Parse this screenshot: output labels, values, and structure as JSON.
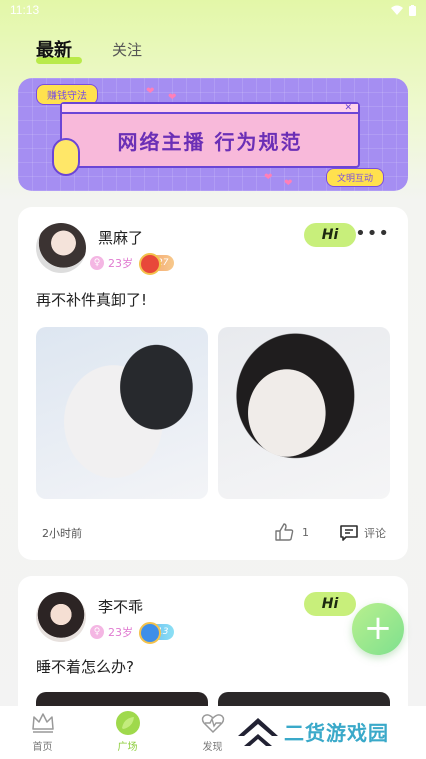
{
  "status_bar": {
    "time": "11:13"
  },
  "tabs": [
    {
      "label": "最新",
      "active": true
    },
    {
      "label": "关注",
      "active": false
    }
  ],
  "banner": {
    "tag": "赚钱守法",
    "title": "网络主播 行为规范",
    "sub": "文明互动"
  },
  "posts": [
    {
      "username": "黑麻了",
      "age": "23岁",
      "level": "27",
      "hi_label": "Hi",
      "text": "再不补件真卸了!",
      "time": "2小时前",
      "likes": "1",
      "comment_label": "评论"
    },
    {
      "username": "李不乖",
      "age": "23岁",
      "level": "13",
      "hi_label": "Hi",
      "text": "睡不着怎么办?"
    }
  ],
  "fab_label": "+",
  "bottom_nav": [
    {
      "label": "首页",
      "icon": "crown-icon",
      "active": false
    },
    {
      "label": "广场",
      "icon": "leaf-icon",
      "active": true
    },
    {
      "label": "发现",
      "icon": "heartbeat-icon",
      "active": false
    }
  ],
  "watermark": {
    "text": "二货游戏园"
  },
  "colors": {
    "accent": "#b9ea4a",
    "hi_button": "#c8ef7b",
    "nav_active": "#8ccd3a",
    "banner_bg": "#a58ef2"
  }
}
